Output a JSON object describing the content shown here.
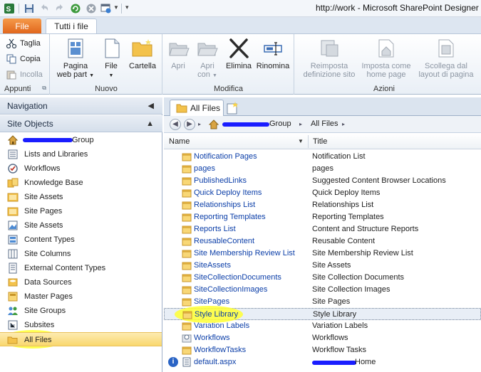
{
  "window": {
    "title": "http://work - Microsoft SharePoint Designer"
  },
  "ribbon": {
    "file_tab": "File",
    "home_tab": "Tutti i file",
    "groups": {
      "clipboard": {
        "label": "Appunti",
        "cut": "Taglia",
        "copy": "Copia",
        "paste": "Incolla"
      },
      "new": {
        "label": "Nuovo",
        "web_part_page_line1": "Pagina",
        "web_part_page_line2": "web part",
        "file": "File",
        "folder": "Cartella"
      },
      "edit": {
        "label": "Modifica",
        "open": "Apri",
        "open_with_line1": "Apri",
        "open_with_line2": "con",
        "delete": "Elimina",
        "rename": "Rinomina"
      },
      "actions": {
        "label": "Azioni",
        "reset_line1": "Reimposta",
        "reset_line2": "definizione sito",
        "set_home_line1": "Imposta come",
        "set_home_line2": "home page",
        "detach_line1": "Scollega dal",
        "detach_line2": "layout di pagina"
      }
    }
  },
  "navigation": {
    "header": "Navigation",
    "site_objects_header": "Site Objects",
    "items": [
      {
        "label": "Group",
        "icon": "home-icon"
      },
      {
        "label": "Lists and Libraries",
        "icon": "list-icon"
      },
      {
        "label": "Workflows",
        "icon": "workflow-icon"
      },
      {
        "label": "Knowledge Base",
        "icon": "knowledge-base-icon"
      },
      {
        "label": "Site Assets",
        "icon": "folder-icon"
      },
      {
        "label": "Site Pages",
        "icon": "folder-icon"
      },
      {
        "label": "Site Assets",
        "icon": "image-library-icon"
      },
      {
        "label": "Content Types",
        "icon": "content-type-icon"
      },
      {
        "label": "Site Columns",
        "icon": "columns-icon"
      },
      {
        "label": "External Content Types",
        "icon": "external-content-icon"
      },
      {
        "label": "Data Sources",
        "icon": "data-source-icon"
      },
      {
        "label": "Master Pages",
        "icon": "master-page-icon"
      },
      {
        "label": "Site Groups",
        "icon": "groups-icon"
      },
      {
        "label": "Subsites",
        "icon": "subsites-icon"
      },
      {
        "label": "All Files",
        "icon": "folder-open-icon"
      }
    ]
  },
  "content": {
    "tab_label": "All Files",
    "breadcrumb": {
      "site": "Group",
      "current": "All Files"
    },
    "columns": {
      "name": "Name",
      "title": "Title"
    },
    "rows": [
      {
        "name": "Notification Pages",
        "title": "Notification List"
      },
      {
        "name": "pages",
        "title": "pages"
      },
      {
        "name": "PublishedLinks",
        "title": "Suggested Content Browser Locations"
      },
      {
        "name": "Quick Deploy Items",
        "title": "Quick Deploy Items"
      },
      {
        "name": "Relationships List",
        "title": "Relationships List"
      },
      {
        "name": "Reporting Templates",
        "title": "Reporting Templates"
      },
      {
        "name": "Reports List",
        "title": "Content and Structure Reports"
      },
      {
        "name": "ReusableContent",
        "title": "Reusable Content"
      },
      {
        "name": "Site Membership Review List",
        "title": "Site Membership Review List"
      },
      {
        "name": "SiteAssets",
        "title": "Site Assets"
      },
      {
        "name": "SiteCollectionDocuments",
        "title": "Site Collection Documents"
      },
      {
        "name": "SiteCollectionImages",
        "title": "Site Collection Images"
      },
      {
        "name": "SitePages",
        "title": "Site Pages"
      },
      {
        "name": "Style Library",
        "title": "Style Library"
      },
      {
        "name": "Variation Labels",
        "title": "Variation Labels"
      },
      {
        "name": "Workflows",
        "title": "Workflows"
      },
      {
        "name": "WorkflowTasks",
        "title": "Workflow Tasks"
      },
      {
        "name": "default.aspx",
        "title": "Home"
      }
    ]
  },
  "colors": {
    "file_tab": "#e0641a",
    "selection": "#f9d76e",
    "link": "#0b3ea8"
  }
}
